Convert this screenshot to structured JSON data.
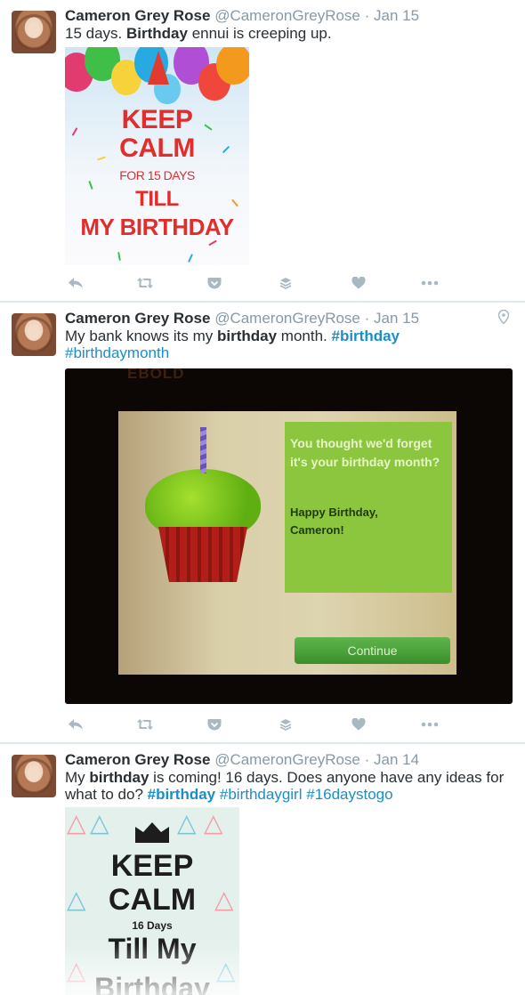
{
  "tweets": [
    {
      "name": "Cameron Grey Rose",
      "handle": "@CameronGreyRose",
      "sep": "·",
      "time": "Jan 15",
      "text": {
        "p1": "15 days. ",
        "b1": "Birthday",
        "p2": " ennui is creeping up."
      },
      "media": {
        "lines": [
          "KEEP",
          "CALM",
          "FOR 15 DAYS",
          "TILL",
          "MY BIRTHDAY"
        ]
      }
    },
    {
      "name": "Cameron Grey Rose",
      "handle": "@CameronGreyRose",
      "sep": "·",
      "time": "Jan 15",
      "text": {
        "p1": "My bank knows its my ",
        "b1": "birthday",
        "p2": " month. ",
        "tag1": "#birthday",
        "tag2": "#birthdaymonth"
      },
      "media": {
        "brand": "EBOLD",
        "message": "You thought we'd forget it's your birthday month?",
        "greeting1": "Happy Birthday,",
        "greeting2": "Cameron!",
        "button": "Continue"
      }
    },
    {
      "name": "Cameron Grey Rose",
      "handle": "@CameronGreyRose",
      "sep": "·",
      "time": "Jan 14",
      "text": {
        "p1": "My ",
        "b1": "birthday",
        "p2": " is coming! 16 days. Does anyone have any ideas for what to do? ",
        "tag1": "#birthday",
        "tag2": "#birthdaygirl",
        "tag3": "#16daystogo"
      },
      "media": {
        "lines": [
          "KEEP",
          "CALM",
          "16 Days",
          "Till My",
          "Birthday"
        ]
      }
    }
  ],
  "icons": [
    "reply-icon",
    "retweet-icon",
    "pocket-icon",
    "buffer-icon",
    "like-icon",
    "more-icon",
    "location-pin-icon"
  ],
  "colors": {
    "link": "#1b8ec9",
    "meta": "#8899a6",
    "action_icon": "#aab8c2",
    "divider": "#e1e8ed"
  }
}
